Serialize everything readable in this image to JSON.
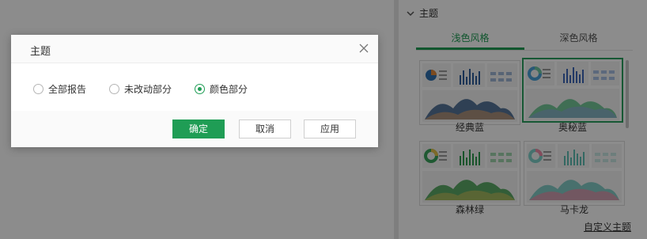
{
  "panel": {
    "section_title": "主题",
    "tabs": [
      {
        "label": "浅色风格",
        "active": true
      },
      {
        "label": "深色风格",
        "active": false
      }
    ],
    "themes": [
      {
        "name": "经典蓝",
        "selected": false
      },
      {
        "name": "奥秘蓝",
        "selected": true
      },
      {
        "name": "森林绿",
        "selected": false
      },
      {
        "name": "马卡龙",
        "selected": false
      }
    ],
    "custom_link": "自定义主题"
  },
  "dialog": {
    "title": "主题",
    "options": [
      {
        "label": "全部报告",
        "checked": false
      },
      {
        "label": "未改动部分",
        "checked": false
      },
      {
        "label": "颜色部分",
        "checked": true
      }
    ],
    "buttons": {
      "confirm": "确定",
      "cancel": "取消",
      "apply": "应用"
    }
  },
  "colors": {
    "accent": "#1f9d55",
    "overlay": "rgba(0,0,0,0.45)"
  }
}
